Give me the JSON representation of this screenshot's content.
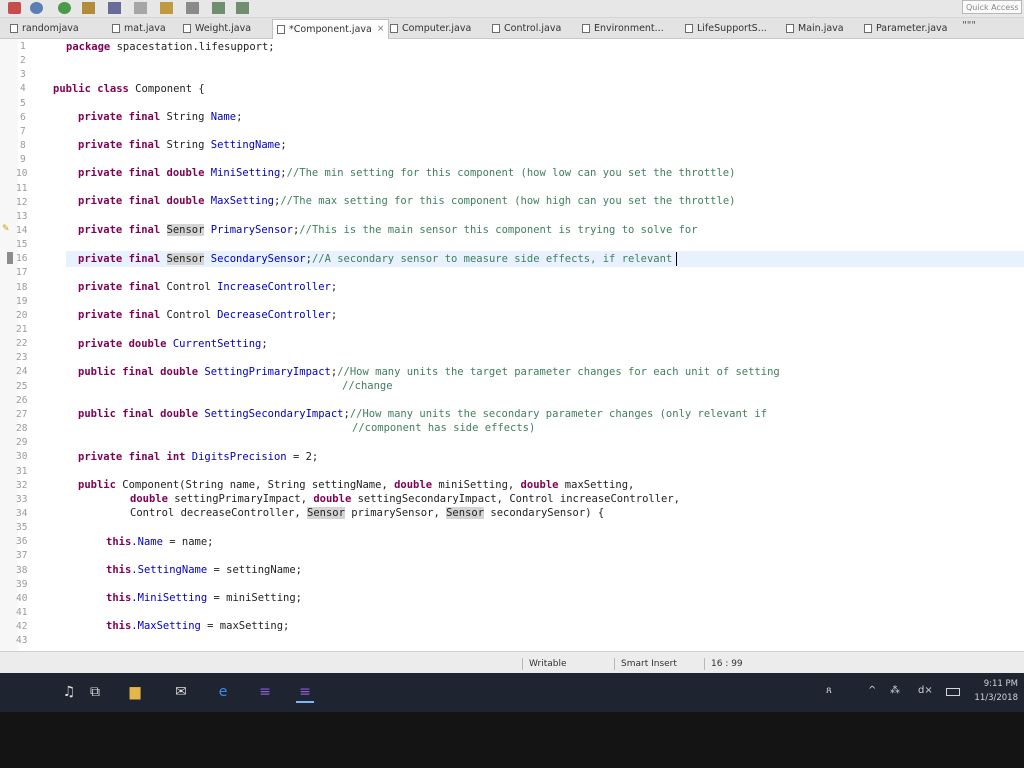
{
  "toolbar": {
    "quick_access": "Quick Access"
  },
  "tabs": [
    {
      "label": "randomjava"
    },
    {
      "label": "mat.java"
    },
    {
      "label": "Weight.java"
    },
    {
      "label": "*Component.java"
    },
    {
      "label": "Computer.java"
    },
    {
      "label": "Control.java"
    },
    {
      "label": "Environment..."
    },
    {
      "label": "LifeSupportS..."
    },
    {
      "label": "Main.java"
    },
    {
      "label": "Parameter.java"
    }
  ],
  "tab_close": "⨯",
  "tab_overflow": "\"\"\"",
  "line_numbers": [
    "1",
    "2",
    "3",
    "4",
    "5",
    "6",
    "7",
    "8",
    "9",
    "10",
    "11",
    "12",
    "13",
    "14",
    "15",
    "16",
    "17",
    "18",
    "19",
    "20",
    "21",
    "22",
    "23",
    "24",
    "25",
    "26",
    "27",
    "28",
    "29",
    "30",
    "31",
    "32",
    "33",
    "34",
    "35",
    "36",
    "37",
    "38",
    "39",
    "40",
    "41",
    "42",
    "43"
  ],
  "code": {
    "l1_kw": "package",
    "l1_rest": " spacestation.lifesupport;",
    "l4_kw": "public class",
    "l4_rest": " Component {",
    "l6_kw": "private final",
    "l6_rest": " String ",
    "l6_fld": "Name",
    "l6_end": ";",
    "l8_kw": "private final",
    "l8_rest": " String ",
    "l8_fld": "SettingName",
    "l8_end": ";",
    "l10_kw": "private final double",
    "l10_fld": " MiniSetting",
    "l10_rest": ";",
    "l10_cmt": "//The min setting for this component (how low can you set the throttle)",
    "l12_kw": "private final double",
    "l12_fld": " MaxSetting",
    "l12_rest": ";",
    "l12_cmt": "//The max setting for this component (how high can you set the throttle)",
    "l14_kw": "private final",
    "l14_type": "Sensor",
    "l14_fld": " PrimarySensor",
    "l14_rest": ";",
    "l14_cmt": "//This is the main sensor this component is trying to solve for",
    "l16_kw": "private final",
    "l16_type": "Sensor",
    "l16_fld": " SecondarySensor",
    "l16_rest": ";",
    "l16_cmt": "//A secondary sensor to measure side effects, if relevant",
    "l18_kw": "private final",
    "l18_rest": " Control ",
    "l18_fld": "IncreaseController",
    "l18_end": ";",
    "l20_kw": "private final",
    "l20_rest": " Control ",
    "l20_fld": "DecreaseController",
    "l20_end": ";",
    "l22_kw": "private double",
    "l22_fld": " CurrentSetting",
    "l22_end": ";",
    "l24_kw": "public final double",
    "l24_fld": " SettingPrimaryImpact",
    "l24_rest": ";",
    "l24_cmt": "//How many units the target parameter changes for each unit of setting",
    "l25_cmt": "//change",
    "l27_kw": "public final double",
    "l27_fld": " SettingSecondaryImpact",
    "l27_rest": ";",
    "l27_cmt": "//How many units the secondary parameter changes (only relevant if",
    "l28_cmt": "//component has side effects)",
    "l30_kw": "private final int",
    "l30_fld": " DigitsPrecision",
    "l30_rest": " = 2;",
    "l32_kw": "public",
    "l32_a": " Component(String name, String settingName, ",
    "l32_kw2": "double",
    "l32_b": " miniSetting, ",
    "l32_kw3": "double",
    "l32_c": " maxSetting,",
    "l33_kw": "double",
    "l33_a": " settingPrimaryImpact, ",
    "l33_kw2": "double",
    "l33_b": " settingSecondaryImpact, Control increaseController,",
    "l34_a": "Control decreaseController, ",
    "l34_type": "Sensor",
    "l34_b": " primarySensor, ",
    "l34_type2": "Sensor",
    "l34_c": " secondarySensor) {",
    "l36_kw": "this",
    "l36_fld": ".Name",
    "l36_rest": " = name;",
    "l38_kw": "this",
    "l38_fld": ".SettingName",
    "l38_rest": " = settingName;",
    "l40_kw": "this",
    "l40_fld": ".MiniSetting",
    "l40_rest": " = miniSetting;",
    "l42_kw": "this",
    "l42_fld": ".MaxSetting",
    "l42_rest": " = maxSetting;"
  },
  "status": {
    "writable": "Writable",
    "insert_mode": "Smart Insert",
    "position": "16 : 99"
  },
  "tray": {
    "time": "9:11 PM",
    "date": "11/3/2018",
    "people": "ጸ",
    "chevron": "^",
    "network": "⁂",
    "volume": "d×"
  },
  "colors": {
    "keyword": "#7f0055",
    "field": "#0000c0",
    "comment": "#3f7f5f",
    "current_line": "#e8f2fe"
  }
}
